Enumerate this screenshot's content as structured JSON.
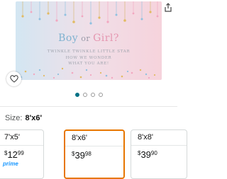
{
  "product": {
    "banner_title_boy": "Boy",
    "banner_title_or": " or ",
    "banner_title_girl": "Girl?",
    "banner_line1": "TWINKLE TWINKLE LITTLE STAR",
    "banner_line2": "HOW WE WONDER",
    "banner_line3": "WHAT YOU ARE!"
  },
  "gallery": {
    "dot_count": 4,
    "active_index": 0
  },
  "size": {
    "label": "Size:",
    "value": "8'x6'"
  },
  "options": [
    {
      "name": "7'x5'",
      "currency": "$",
      "whole": "12",
      "fraction": "99",
      "badge": "prime",
      "selected": false
    },
    {
      "name": "8'x6'",
      "currency": "$",
      "whole": "39",
      "fraction": "98",
      "badge": "",
      "selected": true
    },
    {
      "name": "8'x8'",
      "currency": "$",
      "whole": "39",
      "fraction": "90",
      "badge": "",
      "selected": false
    }
  ],
  "icons": {
    "share": "share-icon",
    "favorite": "heart-icon"
  },
  "colors": {
    "accent": "#e77600",
    "link": "#007185",
    "prime": "#1a98ff"
  }
}
